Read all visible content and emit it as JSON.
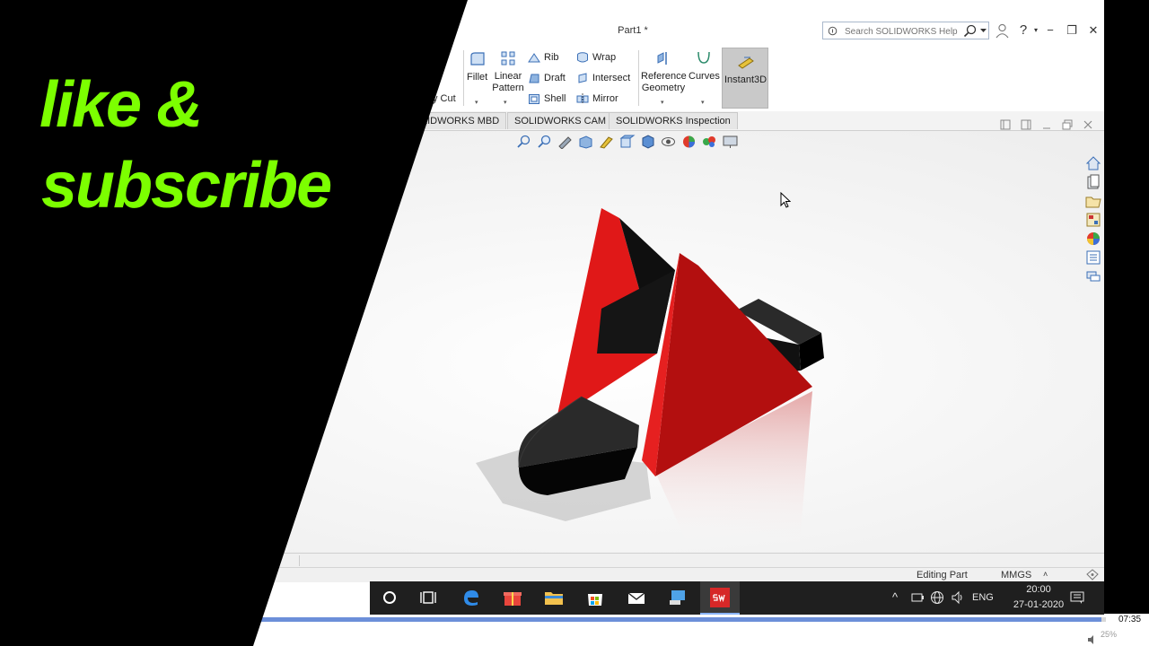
{
  "window": {
    "title": "Part1 *",
    "help_search_placeholder": "Search SOLIDWORKS Help",
    "help_label": "?",
    "minimize_label": "−",
    "restore_label": "❐",
    "close_label": "✕"
  },
  "ribbon": {
    "cut_fragment": "y Cut",
    "fillet": "Fillet",
    "linear_pattern": [
      "Linear",
      "Pattern"
    ],
    "rib": "Rib",
    "draft": "Draft",
    "shell": "Shell",
    "wrap": "Wrap",
    "intersect": "Intersect",
    "mirror": "Mirror",
    "reference_geometry": [
      "Reference",
      "Geometry"
    ],
    "curves": "Curves",
    "instant3d": "Instant3D"
  },
  "tabs": [
    "LIDWORKS MBD",
    "SOLIDWORKS CAM",
    "SOLIDWORKS Inspection"
  ],
  "status_bar": {
    "mode": "Editing Part",
    "units": "MMGS",
    "units_arrow": "˄"
  },
  "taskbar": {
    "language": "ENG",
    "time": "20:00",
    "date": "27-01-2020"
  },
  "video": {
    "current_time": "07:35",
    "progress": 0.995,
    "volume_label": "25%"
  },
  "overlay": {
    "line1": "like &",
    "line2": "subscribe"
  },
  "colors": {
    "promo_text": "#7cff00",
    "model_face": "#c81414",
    "model_boss": "#111111"
  }
}
